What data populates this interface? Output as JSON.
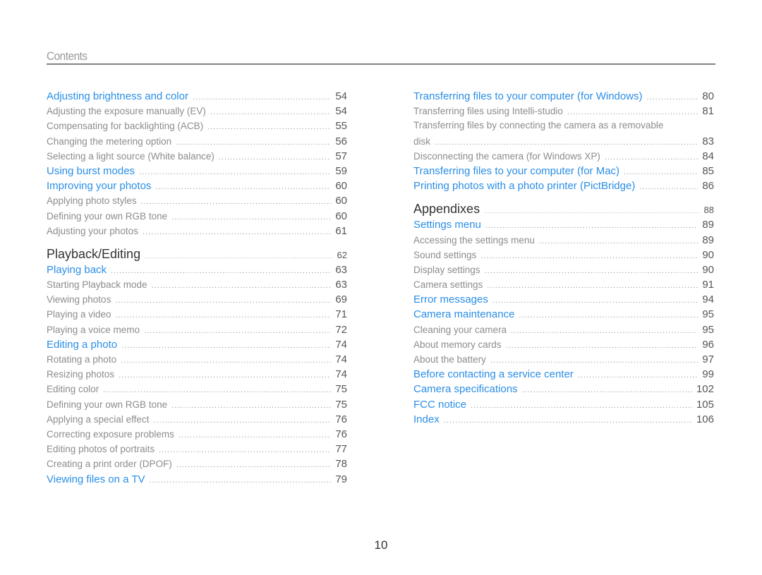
{
  "header": {
    "title": "Contents"
  },
  "page_number": "10",
  "colors": {
    "chapter_link": "#2a8ee6",
    "sub_item": "#8c8c8c",
    "section": "#333333"
  },
  "left_column": [
    {
      "type": "chapter",
      "label": "Adjusting brightness and color",
      "page": "54"
    },
    {
      "type": "sub",
      "label": "Adjusting the exposure manually (EV)",
      "page": "54"
    },
    {
      "type": "sub",
      "label": "Compensating for backlighting (ACB)",
      "page": "55"
    },
    {
      "type": "sub",
      "label": "Changing the metering option",
      "page": "56"
    },
    {
      "type": "sub",
      "label": "Selecting a light source (White balance)",
      "page": "57"
    },
    {
      "type": "chapter",
      "label": "Using burst modes",
      "page": "59"
    },
    {
      "type": "chapter",
      "label": "Improving your photos",
      "page": "60"
    },
    {
      "type": "sub",
      "label": "Applying photo styles",
      "page": "60"
    },
    {
      "type": "sub",
      "label": "Defining your own RGB tone",
      "page": "60"
    },
    {
      "type": "sub",
      "label": "Adjusting your photos",
      "page": "61"
    },
    {
      "type": "section",
      "label": "Playback/Editing",
      "page": "62"
    },
    {
      "type": "chapter",
      "label": "Playing back",
      "page": "63"
    },
    {
      "type": "sub",
      "label": "Starting Playback mode",
      "page": "63"
    },
    {
      "type": "sub",
      "label": "Viewing photos",
      "page": "69"
    },
    {
      "type": "sub",
      "label": "Playing a video",
      "page": "71"
    },
    {
      "type": "sub",
      "label": "Playing a voice memo",
      "page": "72"
    },
    {
      "type": "chapter",
      "label": "Editing a photo",
      "page": "74"
    },
    {
      "type": "sub",
      "label": "Rotating a photo",
      "page": "74"
    },
    {
      "type": "sub",
      "label": "Resizing photos",
      "page": "74"
    },
    {
      "type": "sub",
      "label": "Editing color",
      "page": "75"
    },
    {
      "type": "sub",
      "label": "Defining your own RGB tone",
      "page": "75"
    },
    {
      "type": "sub",
      "label": "Applying a special effect",
      "page": "76"
    },
    {
      "type": "sub",
      "label": "Correcting exposure problems",
      "page": "76"
    },
    {
      "type": "sub",
      "label": "Editing photos of portraits",
      "page": "77"
    },
    {
      "type": "sub",
      "label": "Creating a print order (DPOF)",
      "page": "78"
    },
    {
      "type": "chapter",
      "label": "Viewing files on a TV",
      "page": "79"
    }
  ],
  "right_column": [
    {
      "type": "chapter",
      "label": "Transferring files to your computer (for Windows)",
      "page": "80"
    },
    {
      "type": "sub",
      "label": "Transferring files using Intelli-studio",
      "page": "81"
    },
    {
      "type": "sub-wrap",
      "label": "Transferring files by connecting the camera as a removable",
      "label_cont": "disk",
      "page": "83"
    },
    {
      "type": "sub",
      "label": "Disconnecting the camera (for Windows XP)",
      "page": "84"
    },
    {
      "type": "chapter",
      "label": "Transferring files to your computer (for Mac)",
      "page": "85"
    },
    {
      "type": "chapter",
      "label": "Printing photos with a photo printer (PictBridge)",
      "page": "86"
    },
    {
      "type": "section",
      "label": "Appendixes",
      "page": "88"
    },
    {
      "type": "chapter",
      "label": "Settings menu",
      "page": "89"
    },
    {
      "type": "sub",
      "label": "Accessing the settings menu",
      "page": "89"
    },
    {
      "type": "sub",
      "label": "Sound settings",
      "page": "90"
    },
    {
      "type": "sub",
      "label": "Display settings",
      "page": "90"
    },
    {
      "type": "sub",
      "label": "Camera settings",
      "page": "91"
    },
    {
      "type": "chapter",
      "label": "Error messages",
      "page": "94"
    },
    {
      "type": "chapter",
      "label": "Camera maintenance",
      "page": "95"
    },
    {
      "type": "sub",
      "label": "Cleaning your camera",
      "page": "95"
    },
    {
      "type": "sub",
      "label": "About memory cards",
      "page": "96"
    },
    {
      "type": "sub",
      "label": "About the battery",
      "page": "97"
    },
    {
      "type": "chapter",
      "label": "Before contacting a service center",
      "page": "99"
    },
    {
      "type": "chapter",
      "label": "Camera specifications",
      "page": "102"
    },
    {
      "type": "chapter",
      "label": "FCC notice",
      "page": "105"
    },
    {
      "type": "chapter",
      "label": "Index",
      "page": "106"
    }
  ]
}
